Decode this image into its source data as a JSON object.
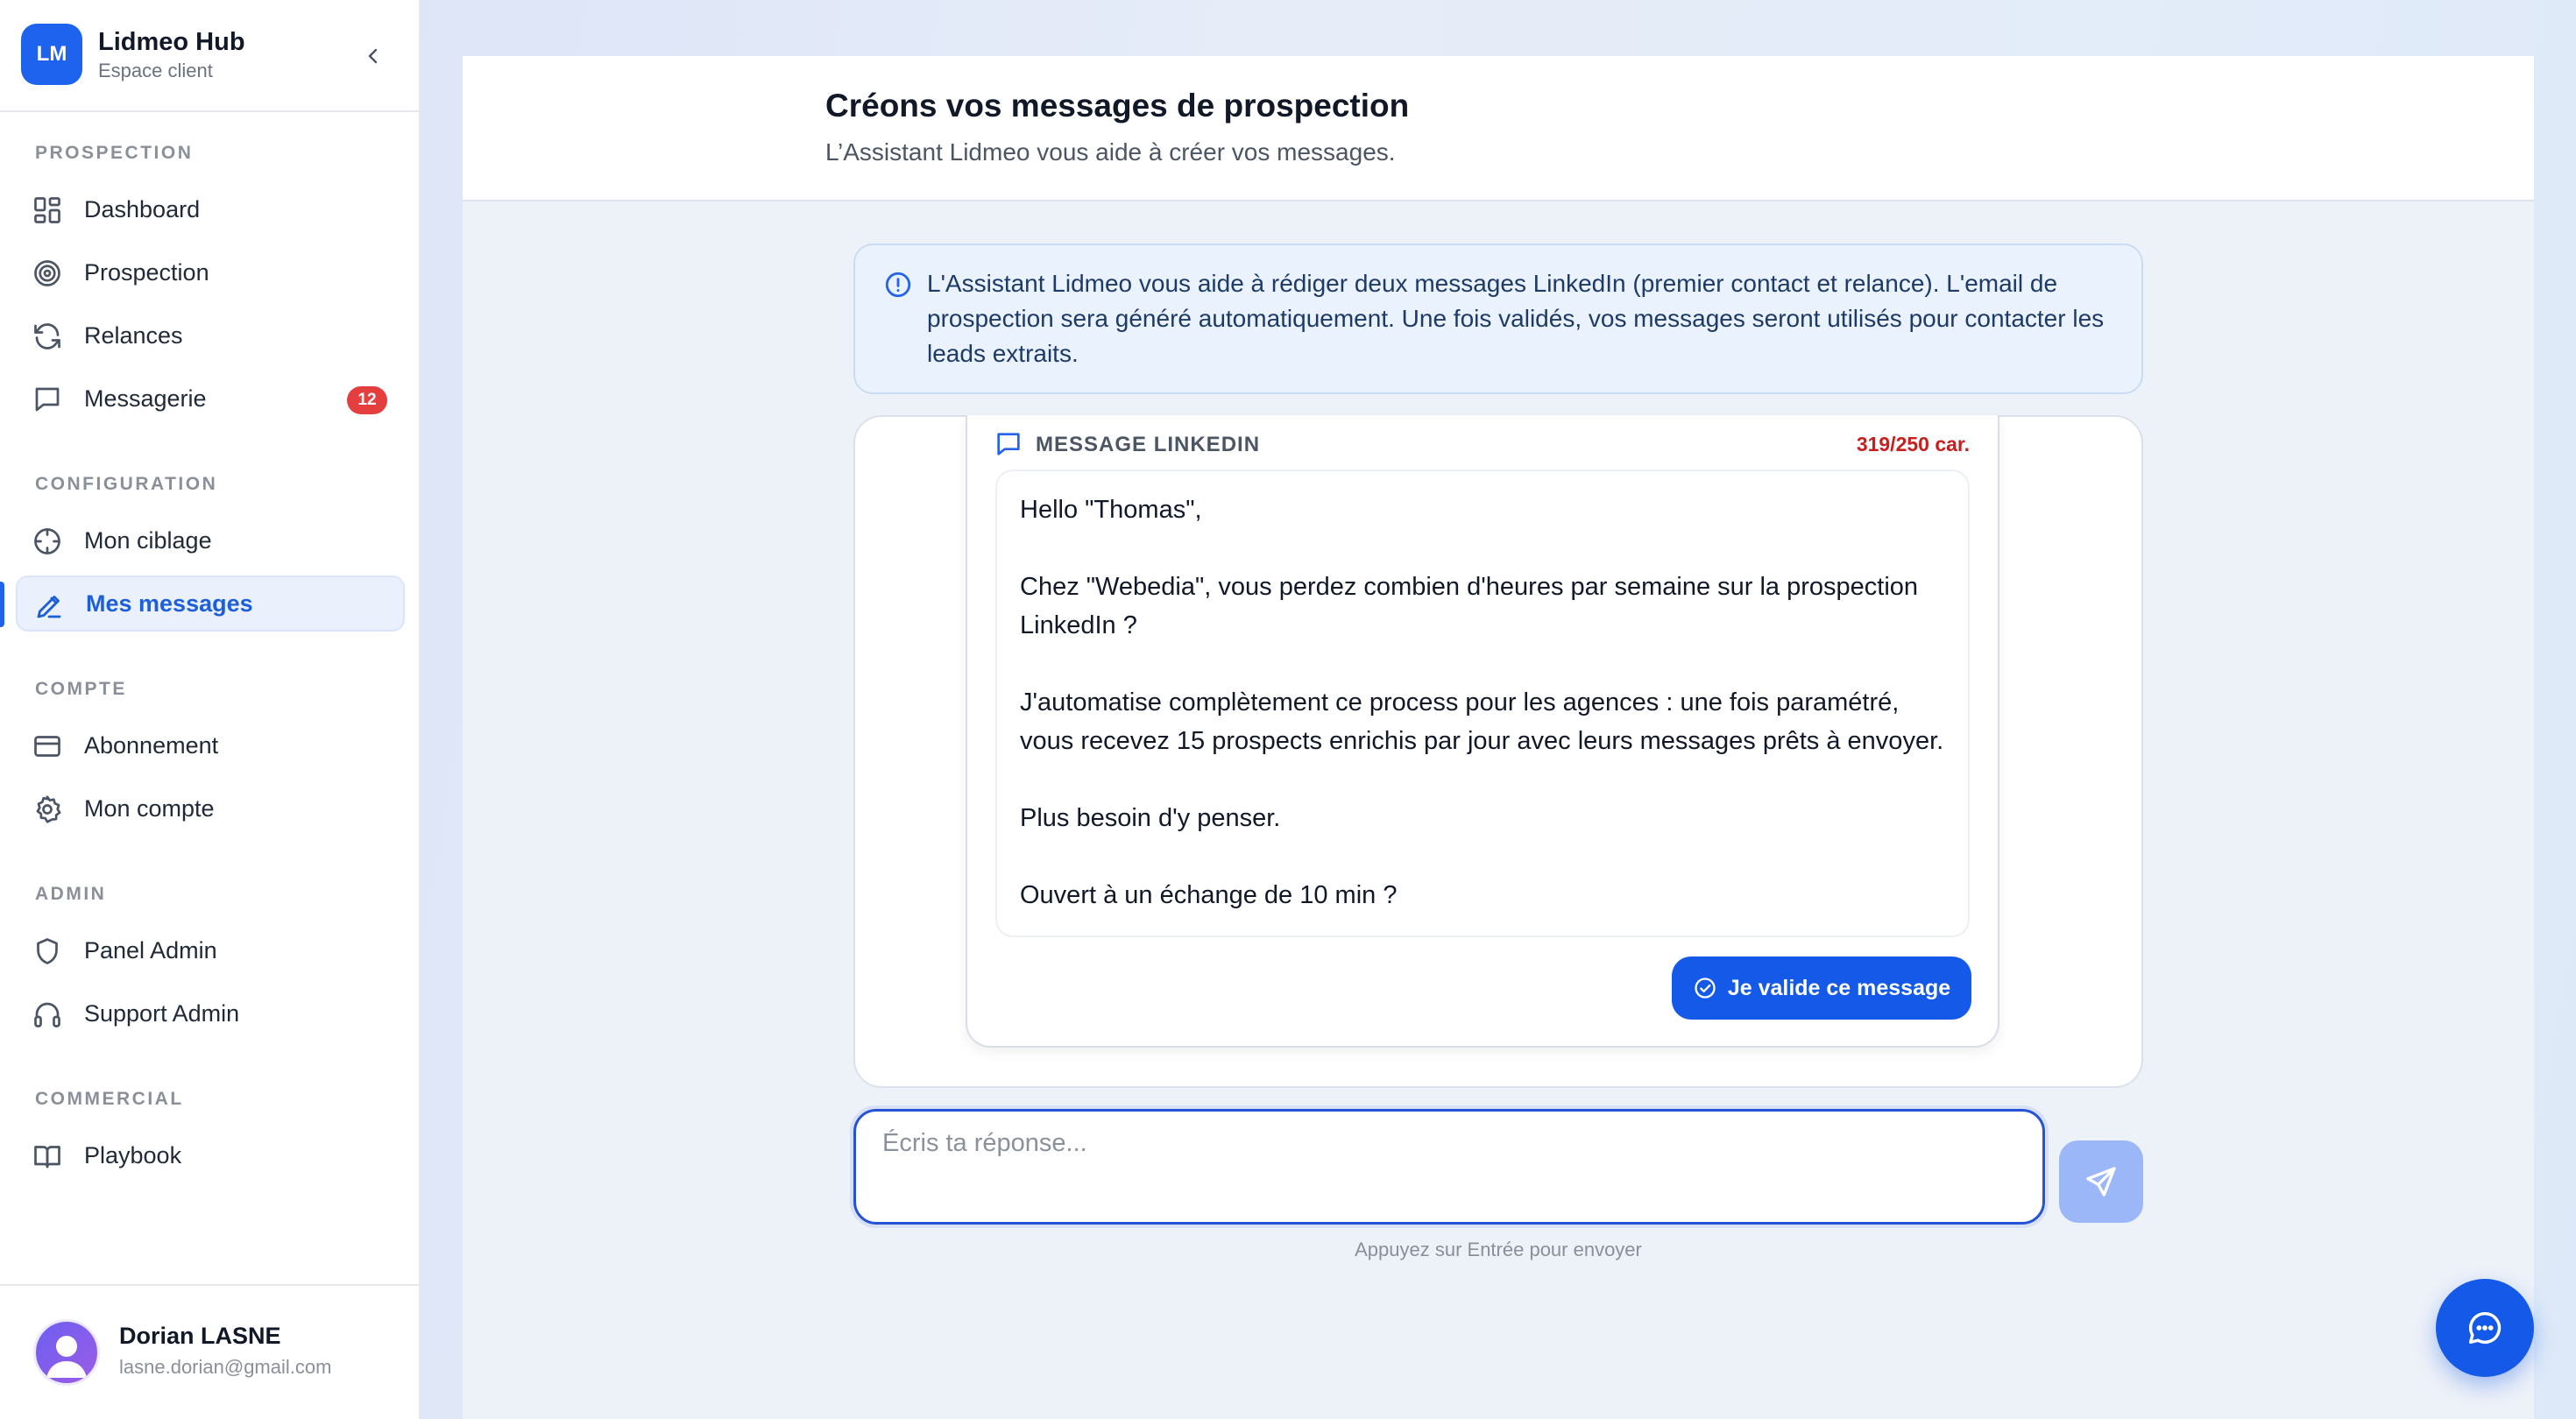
{
  "sidebar": {
    "brand": {
      "logo_text": "LM",
      "name": "Lidmeo Hub",
      "subtitle": "Espace client"
    },
    "sections": [
      {
        "title": "PROSPECTION",
        "items": [
          {
            "label": "Dashboard",
            "icon": "dashboard-icon"
          },
          {
            "label": "Prospection",
            "icon": "target-icon"
          },
          {
            "label": "Relances",
            "icon": "refresh-icon"
          },
          {
            "label": "Messagerie",
            "icon": "chat-bubble-icon",
            "badge": "12"
          }
        ]
      },
      {
        "title": "CONFIGURATION",
        "items": [
          {
            "label": "Mon ciblage",
            "icon": "crosshair-icon"
          },
          {
            "label": "Mes messages",
            "icon": "pencil-icon",
            "active": true
          }
        ]
      },
      {
        "title": "COMPTE",
        "items": [
          {
            "label": "Abonnement",
            "icon": "credit-card-icon"
          },
          {
            "label": "Mon compte",
            "icon": "gear-icon"
          }
        ]
      },
      {
        "title": "ADMIN",
        "items": [
          {
            "label": "Panel Admin",
            "icon": "shield-icon"
          },
          {
            "label": "Support Admin",
            "icon": "headphones-icon"
          }
        ]
      },
      {
        "title": "COMMERCIAL",
        "items": [
          {
            "label": "Playbook",
            "icon": "book-icon"
          }
        ]
      }
    ],
    "user": {
      "name": "Dorian LASNE",
      "email": "lasne.dorian@gmail.com"
    }
  },
  "header": {
    "title": "Créons vos messages de prospection",
    "subtitle": "L’Assistant Lidmeo vous aide à créer vos messages."
  },
  "info": {
    "text": "L'Assistant Lidmeo vous aide à rédiger deux messages LinkedIn (premier contact et relance). L'email de prospection sera généré automatiquement. Une fois validés, vos messages seront utilisés pour contacter les leads extraits."
  },
  "message_card": {
    "label": "MESSAGE LINKEDIN",
    "char_count": "319/250 car.",
    "paragraphs": [
      "Hello \"Thomas\",",
      "Chez \"Webedia\", vous perdez combien d'heures par semaine sur la prospection LinkedIn ?",
      "J'automatise complètement ce process pour les agences : une fois paramétré, vous recevez 15 prospects enrichis par jour avec leurs messages prêts à envoyer.",
      "Plus besoin d'y penser.",
      "Ouvert à un échange de 10 min ?"
    ],
    "validate_label": "Je valide ce message"
  },
  "composer": {
    "placeholder": "Écris ta réponse...",
    "value": "",
    "hint": "Appuyez sur Entrée pour envoyer"
  },
  "colors": {
    "accent": "#1559e8",
    "badge": "#e53e3e",
    "char_over_limit": "#c81e1e",
    "info_bg": "#eaf2fd"
  }
}
